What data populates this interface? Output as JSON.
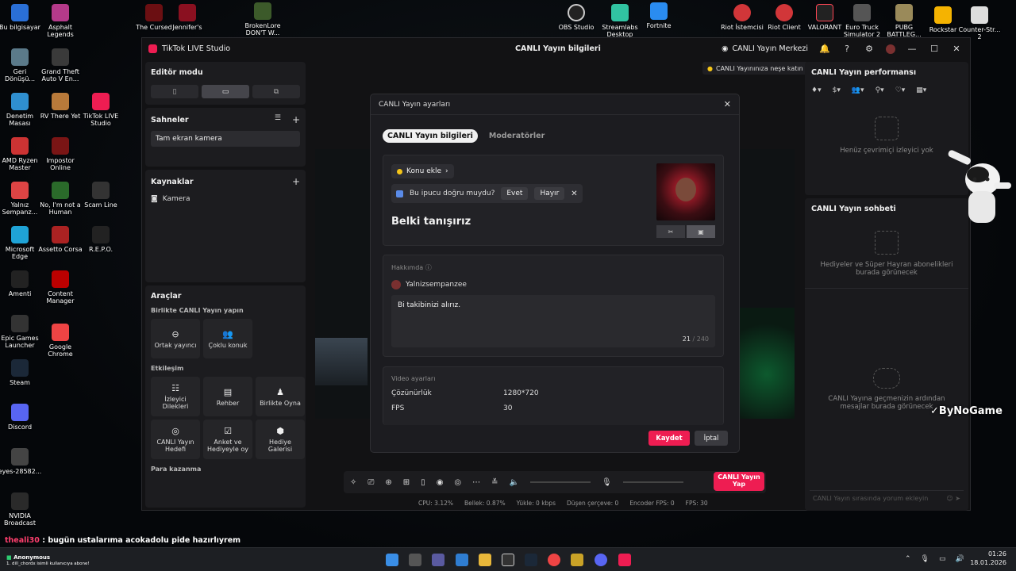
{
  "desktop": {
    "icons_col1": [
      "Bu bilgisayar",
      "Geri Dönüşü...",
      "Denetim Masası",
      "AMD Ryzen Master",
      "Yalnız Sempanz...",
      "Microsoft Edge",
      "Amenti",
      "Epic Games Launcher",
      "Steam",
      "Discord",
      "eyes-28582...",
      "NVIDIA Broadcast"
    ],
    "icons_col2": [
      "Asphalt Legends",
      "Grand Theft Auto V En...",
      "RV There Yet",
      "Impostor Online",
      "No, I'm not a Human",
      "Assetto Corsa",
      "Content Manager",
      "Google Chrome"
    ],
    "icons_col3": [
      "TikTok LIVE Studio",
      "Scam Line",
      "R.E.P.O."
    ],
    "icons_top": [
      "The Cursed",
      "Jennifer's",
      "BrokenLore DON'T W...",
      "OBS Studio",
      "Streamlabs Desktop",
      "Fortnite",
      "Riot İstemcisi",
      "Riot Client",
      "VALORANT",
      "Euro Truck Simulator 2",
      "PUBG BATTLEG...",
      "Rockstar",
      "Counter-Str... 2"
    ]
  },
  "window": {
    "app_title": "TikTok LIVE Studio",
    "center_title": "CANLI Yayın bilgileri",
    "right_link": "CANLI Yayın Merkezi"
  },
  "left": {
    "editor_mode": "Editör modu",
    "scenes_title": "Sahneler",
    "scene_item": "Tam ekran kamera",
    "sources_title": "Kaynaklar",
    "source_item": "Kamera",
    "tools_title": "Araçlar",
    "together_title": "Birlikte CANLI Yayın yapın",
    "together_tools": [
      "Ortak yayıncı",
      "Çoklu konuk"
    ],
    "engagement_title": "Etkileşim",
    "engagement_tools": [
      "İzleyici Dilekleri",
      "Rehber",
      "Birlikte Oyna",
      "CANLI Yayın Hedefi",
      "Anket ve Hediyeyle oy",
      "Hediye Galerisi"
    ],
    "money_title": "Para kazanma"
  },
  "right": {
    "joy_banner": "CANLI Yayınınıza neşe katın",
    "perf_title": "CANLI Yayın performansı",
    "perf_empty": "Henüz çevrimiçi izleyici yok",
    "chat_title": "CANLI Yayın sohbeti",
    "gifts_empty": "Hediyeler ve Süper Hayran abonelikleri burada görünecek",
    "chat_empty": "CANLI Yayına geçmenizin ardından mesajlar burada görünecek",
    "chat_placeholder": "CANLI Yayın sırasında yorum ekleyin"
  },
  "bottom": {
    "go_live": "CANLI Yayın Yap",
    "stats": [
      "CPU: 3.12%",
      "Bellek: 0.87%",
      "Yükle: 0 kbps",
      "Düşen çerçeve: 0",
      "Encoder FPS: 0",
      "FPS: 30"
    ]
  },
  "modal": {
    "title": "CANLI Yayın ayarları",
    "tabs": [
      "CANLI Yayın bilgileri",
      "Moderatörler"
    ],
    "topic_label": "Konu ekle",
    "tip_question": "Bu ipucu doğru muydu?",
    "tip_yes": "Evet",
    "tip_no": "Hayır",
    "stream_title": "Belki tanışırız",
    "about_label": "Hakkımda",
    "username": "Yalnizsempanzee",
    "about_text": "Bi takibinizi alırız.",
    "char_count": "21",
    "char_max": "/ 240",
    "video_settings_label": "Video ayarları",
    "resolution_label": "Çözünürlük",
    "resolution_value": "1280*720",
    "fps_label": "FPS",
    "fps_value": "30",
    "save": "Kaydet",
    "cancel": "İptal"
  },
  "overlay": {
    "chat_user": "theali30",
    "chat_text": " : bugün ustalarıma acokadolu pide hazırlıyrem",
    "sub_user": "Anonymous",
    "sub_text": "1. dill_chordx isimli kullanıcıya abone!",
    "watermark": "ByNoGame"
  },
  "clock": {
    "time": "01:26",
    "date": "18.01.2026"
  }
}
